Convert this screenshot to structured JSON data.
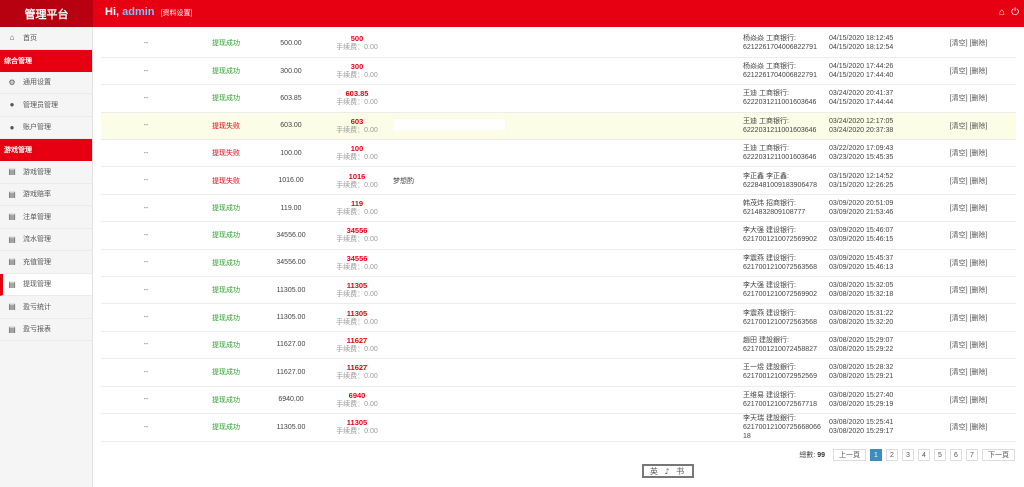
{
  "header": {
    "brand": "管理平台",
    "hi": "Hi, ",
    "username": "admin",
    "settings_link": "[资料设置]"
  },
  "sidebar": {
    "home": "首页",
    "group1": "综合管理",
    "items1": [
      {
        "label": "通用设置",
        "icon": "gear-icon"
      },
      {
        "label": "管理员管理",
        "icon": "user-icon"
      },
      {
        "label": "账户管理",
        "icon": "user-icon"
      }
    ],
    "group2": "游戏管理",
    "items2": [
      {
        "label": "游戏管理",
        "icon": "file-icon"
      },
      {
        "label": "游戏赔率",
        "icon": "file-icon"
      },
      {
        "label": "注单管理",
        "icon": "file-icon"
      },
      {
        "label": "流水管理",
        "icon": "file-icon"
      },
      {
        "label": "充值管理",
        "icon": "file-icon"
      },
      {
        "label": "提现管理",
        "icon": "file-icon"
      },
      {
        "label": "盈亏统计",
        "icon": "file-icon"
      },
      {
        "label": "盈亏报表",
        "icon": "file-icon"
      }
    ]
  },
  "fee_label": "手续费：0.00",
  "rows": [
    {
      "dash": "--",
      "status": "提现成功",
      "amount": "500.00",
      "pay": "500",
      "note": "",
      "bank_name": "杨焱焱 工商银行:",
      "bank_acct": "6212261704006822791",
      "t1": "04/15/2020 18:12:45",
      "t2": "04/15/2020 18:12:54",
      "actions": "[清空] [删除]"
    },
    {
      "dash": "--",
      "status": "提现成功",
      "amount": "300.00",
      "pay": "300",
      "note": "",
      "bank_name": "杨焱焱 工商银行:",
      "bank_acct": "6212261704006822791",
      "t1": "04/15/2020 17:44:26",
      "t2": "04/15/2020 17:44:40",
      "actions": "[清空] [删除]"
    },
    {
      "dash": "--",
      "status": "提现成功",
      "amount": "603.85",
      "pay": "603.85",
      "note": "",
      "bank_name": "王迪 工商银行:",
      "bank_acct": "6222031211001603646",
      "t1": "03/24/2020 20:41:37",
      "t2": "04/15/2020 17:44:44",
      "actions": "[清空] [删除]"
    },
    {
      "dash": "--",
      "status": "提现失败",
      "amount": "603.00",
      "pay": "603",
      "note": "",
      "bank_name": "王迪 工商银行:",
      "bank_acct": "6222031211001603646",
      "t1": "03/24/2020 12:17:05",
      "t2": "03/24/2020 20:37:38",
      "actions": "[清空] [删除]"
    },
    {
      "dash": "--",
      "status": "提现失败",
      "amount": "100.00",
      "pay": "100",
      "note": "",
      "bank_name": "王迪 工商银行:",
      "bank_acct": "6222031211001603646",
      "t1": "03/22/2020 17:09:43",
      "t2": "03/23/2020 15:45:35",
      "actions": "[清空] [删除]"
    },
    {
      "dash": "--",
      "status": "提现失败",
      "amount": "1016.00",
      "pay": "1016",
      "note": "梦想酌",
      "bank_name": "李正鑫 李正鑫:",
      "bank_acct": "6228481009183906478",
      "t1": "03/15/2020 12:14:52",
      "t2": "03/15/2020 12:26:25",
      "actions": "[清空] [删除]"
    },
    {
      "dash": "--",
      "status": "提现成功",
      "amount": "119.00",
      "pay": "119",
      "note": "",
      "bank_name": "韩茂炜 招商银行:",
      "bank_acct": "6214832809108777",
      "t1": "03/09/2020 20:51:09",
      "t2": "03/09/2020 21:53:46",
      "actions": "[清空] [删除]"
    },
    {
      "dash": "--",
      "status": "提现成功",
      "amount": "34556.00",
      "pay": "34556",
      "note": "",
      "bank_name": "李大强 建设银行:",
      "bank_acct": "6217001210072569902",
      "t1": "03/09/2020 15:46:07",
      "t2": "03/09/2020 15:46:15",
      "actions": "[清空] [删除]"
    },
    {
      "dash": "--",
      "status": "提现成功",
      "amount": "34556.00",
      "pay": "34556",
      "note": "",
      "bank_name": "李震燕 建设银行:",
      "bank_acct": "6217001210072563568",
      "t1": "03/09/2020 15:45:37",
      "t2": "03/09/2020 15:46:13",
      "actions": "[清空] [删除]"
    },
    {
      "dash": "--",
      "status": "提现成功",
      "amount": "11305.00",
      "pay": "11305",
      "note": "",
      "bank_name": "李大强 建设银行:",
      "bank_acct": "6217001210072569902",
      "t1": "03/08/2020 15:32:05",
      "t2": "03/08/2020 15:32:18",
      "actions": "[清空] [删除]"
    },
    {
      "dash": "--",
      "status": "提现成功",
      "amount": "11305.00",
      "pay": "11305",
      "note": "",
      "bank_name": "李震燕 建设银行:",
      "bank_acct": "6217001210072563568",
      "t1": "03/08/2020 15:31:22",
      "t2": "03/08/2020 15:32:20",
      "actions": "[清空] [删除]"
    },
    {
      "dash": "--",
      "status": "提现成功",
      "amount": "11627.00",
      "pay": "11627",
      "note": "",
      "bank_name": "趙田 建設銀行:",
      "bank_acct": "6217001210072458827",
      "t1": "03/08/2020 15:29:07",
      "t2": "03/08/2020 15:29:22",
      "actions": "[清空] [删除]"
    },
    {
      "dash": "--",
      "status": "提现成功",
      "amount": "11627.00",
      "pay": "11627",
      "note": "",
      "bank_name": "王一煜 建設銀行:",
      "bank_acct": "6217001210072952569",
      "t1": "03/08/2020 15:28:32",
      "t2": "03/08/2020 15:29:21",
      "actions": "[清空] [删除]"
    },
    {
      "dash": "--",
      "status": "提现成功",
      "amount": "6940.00",
      "pay": "6940",
      "note": "",
      "bank_name": "王维易 建设银行:",
      "bank_acct": "6217001210072567718",
      "t1": "03/08/2020 15:27:40",
      "t2": "03/08/2020 15:29:19",
      "actions": "[清空] [删除]"
    },
    {
      "dash": "--",
      "status": "提现成功",
      "amount": "11305.00",
      "pay": "11305",
      "note": "",
      "bank_name": "李天瑞 建設銀行:",
      "bank_acct": "62170012100725668066 18",
      "t1": "03/08/2020 15:25:41",
      "t2": "03/08/2020 15:29:17",
      "actions": "[清空] [删除]"
    }
  ],
  "pager": {
    "total_label": "總數: ",
    "total": "99",
    "prev": "上一頁",
    "pages": [
      "1",
      "2",
      "3",
      "4",
      "5",
      "6",
      "7"
    ],
    "current": "1",
    "next": "下一頁"
  },
  "stamp_text": "英 ♪ 书",
  "colors": {
    "accent": "#e60012",
    "success": "#2ca02c",
    "pager_active": "#3c8dbc"
  }
}
